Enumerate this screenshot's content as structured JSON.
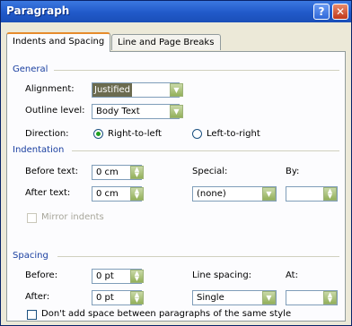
{
  "window": {
    "title": "Paragraph",
    "help_glyph": "?",
    "close_glyph": "✕"
  },
  "tabs": [
    {
      "label": "Indents and Spacing",
      "active": true
    },
    {
      "label": "Line and Page Breaks",
      "active": false
    }
  ],
  "general": {
    "heading": "General",
    "alignment_label": "Alignment:",
    "alignment_value": "Justified",
    "outline_label": "Outline level:",
    "outline_value": "Body Text",
    "direction_label": "Direction:",
    "rtl_label": "Right-to-left",
    "ltr_label": "Left-to-right",
    "direction_selected": "Right-to-left"
  },
  "indentation": {
    "heading": "Indentation",
    "before_label": "Before text:",
    "before_value": "0 cm",
    "after_label": "After text:",
    "after_value": "0 cm",
    "special_label": "Special:",
    "special_value": "(none)",
    "by_label": "By:",
    "by_value": "",
    "mirror_label": "Mirror indents",
    "mirror_checked": false
  },
  "spacing": {
    "heading": "Spacing",
    "before_label": "Before:",
    "before_value": "0 pt",
    "after_label": "After:",
    "after_value": "0 pt",
    "line_spacing_label": "Line spacing:",
    "line_spacing_value": "Single",
    "at_label": "At:",
    "at_value": "",
    "dont_add_label": "Don't add space between paragraphs of the same style",
    "dont_add_checked": false
  },
  "colors": {
    "title_bar": "#2159c9",
    "group_heading": "#1a3fa0",
    "active_tab_accent": "#e68b2c"
  }
}
